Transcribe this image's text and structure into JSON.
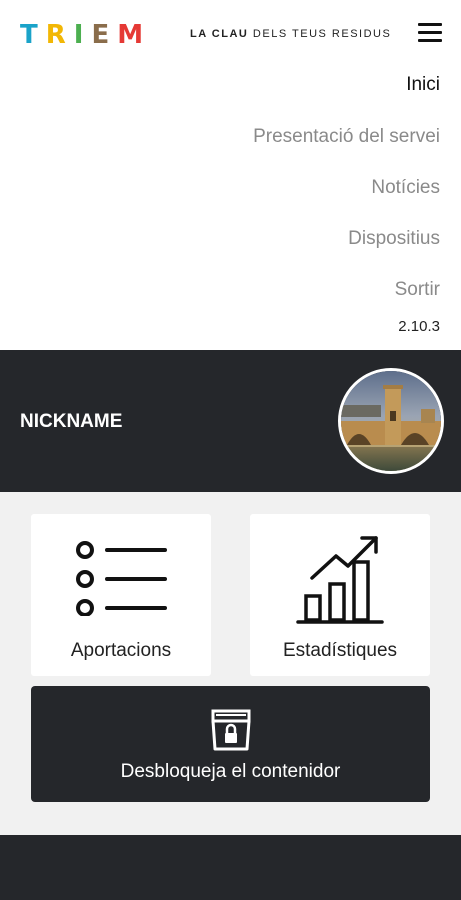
{
  "header": {
    "logo_letters": [
      {
        "char": "T",
        "color": "#1aa3c9"
      },
      {
        "char": "R",
        "color": "#f2b705"
      },
      {
        "char": "I",
        "color": "#4caf50"
      },
      {
        "char": "E",
        "color": "#8a6d4b"
      },
      {
        "char": "M",
        "color": "#e53935"
      }
    ],
    "tagline_bold": "LA CLAU",
    "tagline_rest": " DELS TEUS RESIDUS",
    "menu_icon": "hamburger-icon"
  },
  "menu": {
    "items": [
      "Inici",
      "Presentació del servei",
      "Notícies",
      "Dispositius",
      "Sortir"
    ],
    "active_index": 0,
    "version": "2.10.3"
  },
  "profile": {
    "nickname": "NICKNAME",
    "avatar_icon": "avatar-photo"
  },
  "cards": {
    "contributions": {
      "label": "Aportacions",
      "icon": "list-icon"
    },
    "statistics": {
      "label": "Estadístiques",
      "icon": "bar-chart-icon"
    },
    "unlock": {
      "label": "Desbloqueja el contenidor",
      "icon": "container-lock-icon"
    }
  },
  "colors": {
    "dark": "#25272b",
    "light_bg": "#f1f1f1",
    "menu_inactive": "#8a8a8a"
  }
}
